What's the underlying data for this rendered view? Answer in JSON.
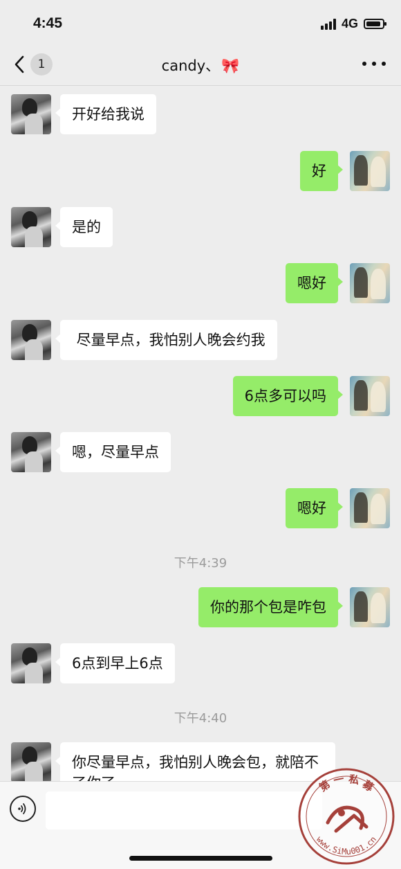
{
  "status_bar": {
    "time": "4:45",
    "network": "4G"
  },
  "nav": {
    "unread_count": "1",
    "title": "candy、",
    "title_emoji": "🎀"
  },
  "messages": [
    {
      "from": "her",
      "text": "开好给我说"
    },
    {
      "from": "me",
      "text": "好"
    },
    {
      "from": "her",
      "text": "是的"
    },
    {
      "from": "me",
      "text": "嗯好"
    },
    {
      "from": "her",
      "text": " 尽量早点，我怕别人晚会约我"
    },
    {
      "from": "me",
      "text": "6点多可以吗"
    },
    {
      "from": "her",
      "text": "嗯，尽量早点"
    },
    {
      "from": "me",
      "text": "嗯好"
    },
    {
      "timestamp": "下午4:39"
    },
    {
      "from": "me",
      "text": "你的那个包是咋包"
    },
    {
      "from": "her",
      "text": "6点到早上6点"
    },
    {
      "timestamp": "下午4:40"
    },
    {
      "from": "her",
      "text": "你尽量早点，我怕别人晚会包，就陪不了你了"
    }
  ],
  "watermark": {
    "text": "第 一 私 募",
    "url": "www.SiMu001.cn"
  }
}
